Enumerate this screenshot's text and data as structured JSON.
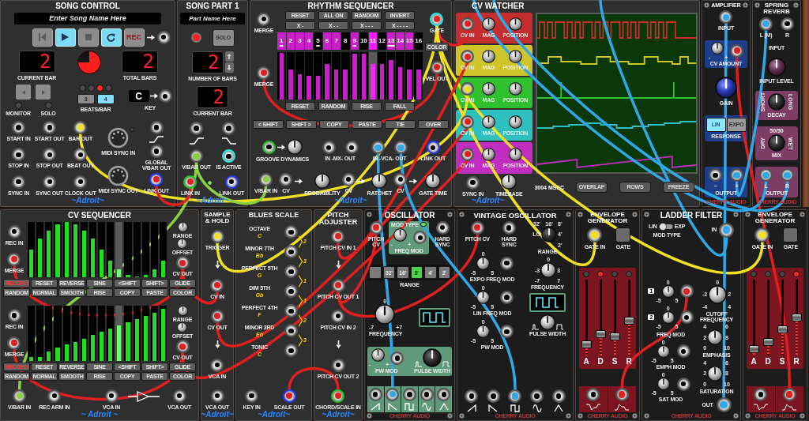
{
  "top_row": [
    {
      "kind": "song_control",
      "title": "SONG CONTROL",
      "song_name": {
        "placeholder": "Enter Song Name Here"
      },
      "transport": [
        {
          "kind": "rewind",
          "on": false
        },
        {
          "kind": "play",
          "on": true
        },
        {
          "kind": "stop",
          "on": false
        },
        {
          "kind": "loop",
          "on": true
        },
        {
          "kind": "record",
          "label": "REC",
          "on": false
        }
      ],
      "current_bar": {
        "value": "2",
        "label": "CURRENT BAR"
      },
      "beat_pie": {
        "level": 0.75
      },
      "total_bars": {
        "value": "2",
        "label": "TOTAL BARS"
      },
      "monitor": {
        "label": "MONITOR",
        "on": false
      },
      "solo": {
        "label": "SOLO",
        "on": false
      },
      "beat_leds": [
        {
          "on": false
        },
        {
          "on": false
        },
        {
          "on": true
        },
        {
          "on": false
        }
      ],
      "beats_per_bar": [
        {
          "label": "3",
          "selected": false
        },
        {
          "label": "4",
          "selected": true
        }
      ],
      "beats_label": "BEATS/BAR",
      "key": {
        "value": "C",
        "label": "KEY"
      },
      "jacks": [
        {
          "label": "START IN"
        },
        {
          "label": "START OUT"
        },
        {
          "label": "BAR OUT",
          "color": "#f0e020"
        },
        {
          "label": "STOP IN"
        },
        {
          "label": "STOP OUT"
        },
        {
          "label": "BEAT OUT"
        },
        {
          "label": "SYNC IN"
        },
        {
          "label": "SYNC OUT"
        },
        {
          "label": "CLOCK OUT"
        }
      ],
      "midi_in": {
        "label": "MIDI SYNC IN",
        "on": false
      },
      "midi_out": {
        "label": "MIDI SYNC OUT"
      },
      "global_out": {
        "label": "GLOBAL V/BAR OUT"
      },
      "link_out": {
        "label": "LINK OUT",
        "kind": "link_out",
        "color": "#e02020"
      },
      "brand": {
        "kind": "adroit",
        "text": "~Adroit~"
      }
    },
    {
      "kind": "song_part",
      "title": "SONG PART 1",
      "part_name": {
        "placeholder": "Part Name Here"
      },
      "record": {
        "on": true
      },
      "solo": {
        "label": "SOLO",
        "on": false
      },
      "bars": {
        "value": "2",
        "label": "NUMBER OF BARS"
      },
      "current_bar": {
        "value": "2",
        "label": "CURRENT BAR"
      },
      "jacks": [
        {
          "label": "V/BAR OUT",
          "color": "#8ad040"
        },
        {
          "label": "IS ACTIVE",
          "kind": "indicator"
        }
      ],
      "link_in": {
        "label": "LINK IN",
        "kind": "link_in",
        "color": "#e02020"
      },
      "link_led": {
        "on": true
      },
      "link_out": {
        "label": "LINK OUT",
        "kind": "link_out"
      },
      "brand": {
        "kind": "adroit",
        "text": "~Adroit~"
      }
    },
    {
      "kind": "rhythm_sequencer",
      "title": "RHYTHM SEQUENCER",
      "merge": [
        {
          "label": "MERGE"
        },
        {
          "label": "MERGE",
          "color": "#e02020"
        }
      ],
      "pattern_buttons": [
        {
          "label": "RESET"
        },
        {
          "label": "ALL ON"
        },
        {
          "label": "RANDOM"
        },
        {
          "label": "INVERT"
        }
      ],
      "length_buttons": [
        {
          "label": "X -"
        },
        {
          "label": "X - -"
        },
        {
          "label": "X - - -"
        },
        {
          "label": "X - - - -"
        }
      ],
      "steps": [
        {
          "label": "1",
          "on": true,
          "marked": true,
          "playing": false,
          "level": 0.98
        },
        {
          "label": "2",
          "on": true,
          "marked": false,
          "playing": false,
          "level": 0.62
        },
        {
          "label": "3",
          "on": true,
          "marked": false,
          "playing": false,
          "level": 0.53
        },
        {
          "label": "4",
          "on": true,
          "marked": false,
          "playing": false,
          "level": 0.5
        },
        {
          "label": "5",
          "on": false,
          "marked": true,
          "playing": false,
          "level": 0.5
        },
        {
          "label": "6",
          "on": true,
          "marked": false,
          "playing": false,
          "level": 0.75
        },
        {
          "label": "7",
          "on": true,
          "marked": false,
          "playing": false,
          "level": 0.62
        },
        {
          "label": "8",
          "on": false,
          "marked": false,
          "playing": false,
          "level": 0.62
        },
        {
          "label": "9",
          "on": true,
          "marked": true,
          "playing": false,
          "level": 0.96
        },
        {
          "label": "10",
          "on": false,
          "marked": false,
          "playing": false,
          "level": 0.96
        },
        {
          "label": "11",
          "on": true,
          "marked": false,
          "playing": true,
          "level": 0.75
        },
        {
          "label": "12",
          "on": false,
          "marked": false,
          "playing": false,
          "level": 0.75
        },
        {
          "label": "13",
          "on": true,
          "marked": true,
          "playing": false,
          "level": 0.83
        },
        {
          "label": "14",
          "on": true,
          "marked": false,
          "playing": false,
          "level": 0.67
        },
        {
          "label": "15",
          "on": true,
          "marked": false,
          "playing": false,
          "level": 0.62
        },
        {
          "label": "16",
          "on": false,
          "marked": false,
          "playing": false,
          "level": 0.62
        }
      ],
      "velocity_buttons": [
        {
          "label": "RESET"
        },
        {
          "label": "RANDOM"
        },
        {
          "label": "RISE"
        },
        {
          "label": "FALL"
        }
      ],
      "edit_buttons": [
        {
          "label": "< SHIFT"
        },
        {
          "label": "SHIFT >"
        },
        {
          "label": "COPY"
        },
        {
          "label": "PASTE"
        },
        {
          "label": "TIE"
        },
        {
          "label": "OVER"
        }
      ],
      "gate": {
        "label": "GATE",
        "kind": "indicator",
        "color": "#e02020"
      },
      "color_button": {
        "label": "COLOR"
      },
      "vel_out": {
        "label": "VEL OUT",
        "color": "#e02020"
      },
      "groove": {
        "label": "GROOVE DYNAMICS",
        "jack": {
          "kind": "link_in"
        }
      },
      "mix": {
        "label": "IN -MX- OUT"
      },
      "vca": {
        "label": "IN -VCA- OUT",
        "jacks": [
          {
            "color": "#30a8e8"
          },
          {
            "color": "#30a8e8"
          }
        ]
      },
      "link_out": {
        "label": "LINK OUT",
        "kind": "link_out"
      },
      "mod_row": [
        {
          "kind": "jack",
          "label": "V/BAR IN",
          "color": "#8ad040"
        },
        {
          "kind": "jack",
          "label": "CV"
        },
        {
          "kind": "knob",
          "label": "PROBABILITY"
        },
        {
          "kind": "jack",
          "label": "CV"
        },
        {
          "kind": "knob",
          "label": "RATCHET"
        },
        {
          "kind": "jack",
          "label": "CV"
        },
        {
          "kind": "knob",
          "label": "GATE TIME"
        }
      ],
      "brand": {
        "kind": "adroit",
        "text": "~Adroit~"
      }
    },
    {
      "kind": "cv_watcher",
      "title": "CV WATCHER",
      "channels": [
        {
          "color": "#c42e2e",
          "input": {
            "label": "CV IN",
            "color": "#e02020"
          },
          "mag": {
            "label": "MAG"
          },
          "position": {
            "label": "POSITION"
          }
        },
        {
          "color": "#cfc52a",
          "input": {
            "label": "CV IN",
            "color": "#e02020"
          },
          "mag": {
            "label": "MAG"
          },
          "position": {
            "label": "POSITION"
          }
        },
        {
          "color": "#2fbf2f",
          "input": {
            "label": "CV IN",
            "color": "#f0e020"
          },
          "mag": {
            "label": "MAG"
          },
          "position": {
            "label": "POSITION"
          }
        },
        {
          "color": "#2ebfbf",
          "input": {
            "label": "CV IN",
            "color": "#e02020"
          },
          "mag": {
            "label": "MAG"
          },
          "position": {
            "label": "POSITION"
          }
        },
        {
          "color": "#bf2ebf",
          "input": {
            "label": "CV IN",
            "color": "#e02020"
          },
          "mag": {
            "label": "MAG"
          },
          "position": {
            "label": "POSITION"
          }
        }
      ],
      "sync_in": {
        "label": "SYNC IN"
      },
      "timebase": {
        "label": "TIMEBASE"
      },
      "readout": "3004 MSEC",
      "buttons": [
        {
          "label": "OVERLAP"
        },
        {
          "label": "ROWS"
        },
        {
          "label": "FREEZE"
        }
      ],
      "brand": {
        "kind": "adroit",
        "text": "~Adroit~"
      }
    },
    {
      "kind": "amplifier",
      "title": "AMPLIFIER",
      "input": {
        "label": "INPUT",
        "color": "#30a8e8"
      },
      "cv_amount": {
        "label": "CV AMOUNT",
        "scale": [
          "-",
          "+"
        ],
        "jack": {
          "color": "#e02020"
        }
      },
      "gain": {
        "label": "GAIN"
      },
      "response": {
        "label": "RESPONSE",
        "options": [
          {
            "label": "LIN",
            "selected": true
          },
          {
            "label": "EXPO",
            "selected": false
          }
        ]
      },
      "outputs": [
        {
          "label": "−"
        },
        {
          "label": "+",
          "color": "#30a8e8"
        }
      ],
      "output_label": "OUTPUT",
      "brand": {
        "kind": "cherry",
        "text": "CHERRY AUDIO"
      }
    },
    {
      "kind": "spring_reverb",
      "title": "SPRING REVERB",
      "inputs": [
        {
          "label": "L (M)",
          "color": "#30a8e8"
        },
        {
          "label": "R"
        }
      ],
      "input_label": "INPUT",
      "input_level": {
        "label": "INPUT LEVEL"
      },
      "decay": {
        "label": "DECAY",
        "min": "SHORT",
        "max": "LONG"
      },
      "mix": {
        "label": "MIX",
        "center": "50/50",
        "min": "DRY",
        "max": "WET"
      },
      "outputs": [
        {
          "label": "L",
          "color": "#30a8e8"
        },
        {
          "label": "R",
          "color": "#30a8e8"
        }
      ],
      "output_label": "OUTPUT",
      "brand": {
        "kind": "cherry",
        "text": "CHERRY AUDIO"
      }
    }
  ],
  "bottom_row": [
    {
      "kind": "cv_sequencer",
      "title": "CV SEQUENCER",
      "lanes": [
        {
          "rec_in": {
            "label": "REC IN"
          },
          "merge": {
            "label": "MERGE",
            "color": "#e02020"
          },
          "steps": [
            {
              "level": 0.5,
              "playing": false
            },
            {
              "level": 0.69,
              "playing": false
            },
            {
              "level": 0.84,
              "playing": false
            },
            {
              "level": 0.95,
              "playing": false
            },
            {
              "level": 1,
              "playing": false
            },
            {
              "level": 0.95,
              "playing": false
            },
            {
              "level": 0.84,
              "playing": false
            },
            {
              "level": 0.69,
              "playing": false
            },
            {
              "level": 0.5,
              "playing": false
            },
            {
              "level": 0.29,
              "playing": false
            },
            {
              "level": 0.14,
              "playing": true
            },
            {
              "level": 0.03,
              "playing": false
            },
            {
              "level": 0,
              "playing": false
            },
            {
              "level": 0.03,
              "playing": false
            },
            {
              "level": 0.14,
              "playing": false
            },
            {
              "level": 0.29,
              "playing": false
            }
          ],
          "range": {
            "label": "RANGE"
          },
          "offset": {
            "label": "OFFSET"
          },
          "cv_out": {
            "label": "CV OUT",
            "color": "#e02020"
          },
          "buttons": [
            {
              "label": "RECORD",
              "kind": "record"
            },
            {
              "label": "RESET",
              "kind": "normal"
            },
            {
              "label": "REVERSE",
              "kind": "normal"
            },
            {
              "label": "SINE",
              "kind": "normal"
            },
            {
              "label": "<SHIFT",
              "kind": "normal"
            },
            {
              "label": "SHIFT>",
              "kind": "normal"
            },
            {
              "label": "GLIDE",
              "kind": "normal"
            },
            {
              "label": "RANDOM",
              "kind": "normal"
            },
            {
              "label": "NORMAL",
              "kind": "normal"
            },
            {
              "label": "SMOOTH",
              "kind": "normal"
            },
            {
              "label": "RISE",
              "kind": "normal"
            },
            {
              "label": "COPY",
              "kind": "normal"
            },
            {
              "label": "PASTE",
              "kind": "normal"
            },
            {
              "label": "COLOR",
              "kind": "normal"
            }
          ]
        },
        {
          "rec_in": {
            "label": "REC IN"
          },
          "merge": {
            "label": "MERGE",
            "color": "#e02020"
          },
          "steps": [
            {
              "level": 0.06,
              "playing": false
            },
            {
              "level": 0.06,
              "playing": false
            },
            {
              "level": 0.17,
              "playing": false
            },
            {
              "level": 0.23,
              "playing": false
            },
            {
              "level": 0.3,
              "playing": false
            },
            {
              "level": 0.34,
              "playing": false
            },
            {
              "level": 0.4,
              "playing": false
            },
            {
              "level": 0.46,
              "playing": false
            },
            {
              "level": 0.52,
              "playing": false
            },
            {
              "level": 0.58,
              "playing": false
            },
            {
              "level": 0.64,
              "playing": true
            },
            {
              "level": 0.7,
              "playing": false
            },
            {
              "level": 0.75,
              "playing": false
            },
            {
              "level": 0.81,
              "playing": false
            },
            {
              "level": 0.87,
              "playing": false
            },
            {
              "level": 0.93,
              "playing": false
            }
          ],
          "range": {
            "label": "RANGE"
          },
          "offset": {
            "label": "OFFSET"
          },
          "cv_out": {
            "label": "CV OUT",
            "color": "#e02020"
          },
          "buttons": [
            {
              "label": "RECORD",
              "kind": "record"
            },
            {
              "label": "RESET",
              "kind": "normal"
            },
            {
              "label": "REVERSE",
              "kind": "normal"
            },
            {
              "label": "SINE",
              "kind": "normal"
            },
            {
              "label": "<SHIFT",
              "kind": "normal"
            },
            {
              "label": "SHIFT>",
              "kind": "normal"
            },
            {
              "label": "GLIDE",
              "kind": "normal"
            },
            {
              "label": "RANDOM",
              "kind": "normal"
            },
            {
              "label": "NORMAL",
              "kind": "normal"
            },
            {
              "label": "SMOOTH",
              "kind": "normal"
            },
            {
              "label": "RISE",
              "kind": "normal"
            },
            {
              "label": "COPY",
              "kind": "normal"
            },
            {
              "label": "PASTE",
              "kind": "normal"
            },
            {
              "label": "COLOR",
              "kind": "normal"
            }
          ]
        }
      ],
      "v_bar_in": {
        "label": "V/BAR IN",
        "color": "#8ad040"
      },
      "rec_arm_in": {
        "label": "REC ARM IN"
      },
      "vca_in": {
        "label": "VCA IN"
      },
      "vca_out": {
        "label": "VCA OUT"
      },
      "brand": {
        "kind": "adroit",
        "text": "~ Adroit ~"
      }
    },
    {
      "kind": "sample_hold",
      "title": "SAMPLE & HOLD",
      "trigger": {
        "label": "TRIGGER",
        "color": "#f0e020"
      },
      "cv_in": {
        "label": "CV IN",
        "color": "#e02020"
      },
      "cv_out": {
        "label": "CV OUT",
        "color": "#e02020"
      },
      "vca_in": {
        "label": "VCA IN"
      },
      "vca_out": {
        "label": "VCA OUT"
      },
      "brand": {
        "kind": "adroit",
        "text": "~Adroit~"
      }
    },
    {
      "kind": "blues_scale",
      "title": "BLUES SCALE",
      "notes": [
        {
          "label": "OCTAVE",
          "note": "C"
        },
        {
          "label": "MINOR 7TH",
          "note": "Bb"
        },
        {
          "label": "PERFECT 5TH",
          "note": "G"
        },
        {
          "label": "DIM 5TH",
          "note": "Gb"
        },
        {
          "label": "PERFECT 4TH",
          "note": "F"
        },
        {
          "label": "MINOR 3RD",
          "note": "Eb"
        },
        {
          "label": "TONIC",
          "note": "C"
        }
      ],
      "intervals": [
        "2",
        "3",
        "1",
        "1",
        "2",
        "3"
      ],
      "key_in": {
        "label": "KEY IN"
      },
      "scale_out": {
        "label": "SCALE OUT",
        "kind": "link_out",
        "color": "#e02020"
      },
      "brand": {
        "kind": "adroit",
        "text": "~Adroit~"
      }
    },
    {
      "kind": "pitch_adjuster",
      "title": "PITCH ADJUSTER",
      "jacks": [
        {
          "label": "PITCH CV IN 1",
          "color": "#e02020"
        },
        {
          "label": "PITCH CV OUT 1",
          "color": "#e02020"
        },
        {
          "label": "PITCH CV IN 2"
        },
        {
          "label": "PITCH CV OUT 2"
        }
      ],
      "chord_in": {
        "label": "CHORD/SCALE IN",
        "kind": "link_in",
        "color": "#e02020"
      },
      "brand": {
        "kind": "adroit",
        "text": "~Adroit~"
      }
    },
    {
      "kind": "oscillator",
      "title": "OSCILLATOR",
      "pitch_cv": {
        "label": "PITCH CV",
        "color": "#e02020"
      },
      "mod_type": {
        "label": "MOD TYPE",
        "on": true
      },
      "freq_mod": {
        "label": "FREQ MOD",
        "scale": [
          "-",
          "+"
        ]
      },
      "hard_sync": {
        "label": "HARD SYNC"
      },
      "ranges": [
        {
          "selected": false
        },
        {
          "label": "32'",
          "selected": false
        },
        {
          "label": "16'",
          "selected": false
        },
        {
          "label": "8'",
          "selected": true
        },
        {
          "label": "4'",
          "selected": false
        },
        {
          "label": "2'",
          "selected": false
        }
      ],
      "range_label": "RANGE",
      "frequency": {
        "label": "FREQUENCY",
        "scale": [
          "0",
          "-7",
          "+7"
        ]
      },
      "pw_mod": {
        "label": "PW MOD",
        "scale": [
          "-",
          "+"
        ]
      },
      "pulse_width": {
        "label": "PULSE WIDTH"
      },
      "outputs": [
        {
          "kind": "saw"
        },
        {
          "kind": "ramp",
          "color": "#30a8e8"
        },
        {
          "kind": "square"
        },
        {
          "kind": "sine"
        },
        {
          "kind": "triangle"
        }
      ],
      "brand": {
        "kind": "cherry",
        "text": "CHERRY AUDIO"
      }
    },
    {
      "kind": "vintage_oscillator",
      "title": "VINTAGE OSCILLATOR",
      "pitch_cv": {
        "label": "PITCH CV",
        "color": "#e02020"
      },
      "hard_sync": {
        "label": "HARD SYNC"
      },
      "range": {
        "label": "RANGE",
        "kind": "selector",
        "scale": [
          "32'",
          "16'",
          "8'",
          "LO",
          "4'",
          "2'"
        ]
      },
      "mods": [
        {
          "label": "EXPO FREQ MOD",
          "scale": [
            "0",
            "-5",
            "5"
          ]
        },
        {
          "label": "LIN FREQ MOD",
          "scale": [
            "0",
            "-5",
            "5"
          ]
        },
        {
          "label": "PW MOD",
          "scale": [
            "0",
            "-5",
            "5"
          ]
        }
      ],
      "frequency": {
        "label": "FREQUENCY",
        "scale": [
          "0",
          "-3",
          "3",
          "-7",
          "7"
        ]
      },
      "pulse_width": {
        "label": "PULSE WIDTH"
      },
      "outputs": [
        {
          "kind": "saw"
        },
        {
          "kind": "ramp"
        },
        {
          "kind": "square",
          "color": "#30a8e8"
        },
        {
          "kind": "sine"
        },
        {
          "kind": "triangle"
        }
      ],
      "brand": {
        "kind": "cherry",
        "text": "CHERRY AUDIO"
      }
    },
    {
      "kind": "envelope",
      "title": "ENVELOPE GENERATOR",
      "gate_in": {
        "label": "GATE IN",
        "color": "#f0e020"
      },
      "gate_button": {
        "label": "GATE",
        "on": false
      },
      "stages": [
        {
          "label": "A",
          "on": false,
          "level": 0.1
        },
        {
          "label": "D",
          "on": true,
          "level": 0.25
        },
        {
          "label": "S",
          "on": false,
          "level": 0.22
        },
        {
          "label": "R",
          "on": false,
          "level": 0.45
        }
      ],
      "outputs": [
        {
          "kind": "inverted"
        },
        {
          "kind": "normal",
          "color": "#e02020"
        }
      ],
      "brand": {
        "kind": "cherry",
        "text": "CHERRY AUDIO"
      }
    },
    {
      "kind": "ladder_filter",
      "title": "LADDER FILTER",
      "mod_type": {
        "label": "MOD TYPE",
        "low": "LIN",
        "high": "EXP",
        "on": false
      },
      "input": {
        "label": "IN",
        "color": "#30a8e8"
      },
      "freq_mods": [
        {
          "badge": "1",
          "scale": [
            "0",
            "-5",
            "5"
          ],
          "jack": {
            "color": "#e02020"
          }
        },
        {
          "badge": "2",
          "scale": [
            "0",
            "-5",
            "5"
          ]
        }
      ],
      "freq_mod_label": "FREQ MOD",
      "cutoff": {
        "label": "CUTOFF FREQUENCY",
        "scale": [
          "0",
          "-2",
          "2",
          "-4",
          "4"
        ]
      },
      "emphasis": {
        "label": "EMPHASIS",
        "scale": [
          "4",
          "6",
          "2",
          "8",
          "0",
          "10"
        ]
      },
      "emph_mod": {
        "label": "EMPH MOD",
        "scale": [
          "0",
          "-5",
          "5"
        ]
      },
      "saturation": {
        "label": "SATURATION",
        "scale": [
          "4",
          "6",
          "2",
          "8",
          "0",
          "10"
        ]
      },
      "sat_mod": {
        "label": "SAT MOD",
        "scale": [
          "0",
          "-5",
          "5"
        ]
      },
      "output": {
        "label": "OUT",
        "color": "#30a8e8"
      },
      "brand": {
        "kind": "cherry",
        "text": "CHERRY AUDIO"
      }
    },
    {
      "kind": "envelope",
      "title": "ENVELOPE GENERATOR",
      "gate_in": {
        "label": "GATE IN",
        "color": "#f0e020"
      },
      "gate_button": {
        "label": "GATE",
        "on": false
      },
      "stages": [
        {
          "label": "A",
          "on": false,
          "level": 0.03
        },
        {
          "label": "D",
          "on": false,
          "level": 0.13
        },
        {
          "label": "S",
          "on": false,
          "level": 0.32
        },
        {
          "label": "R",
          "on": true,
          "level": 0.5
        }
      ],
      "outputs": [
        {
          "kind": "inverted"
        },
        {
          "kind": "normal",
          "color": "#e02020"
        }
      ],
      "brand": {
        "kind": "cherry",
        "text": "CHERRY AUDIO"
      }
    }
  ]
}
